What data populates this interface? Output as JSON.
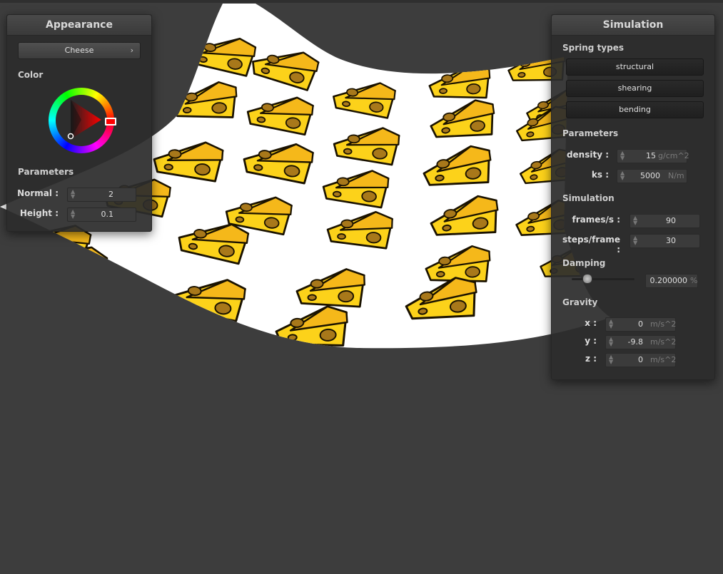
{
  "appearance": {
    "title": "Appearance",
    "texture_select": "Cheese",
    "color_label": "Color",
    "parameters_label": "Parameters",
    "normal": {
      "label": "Normal :",
      "value": "2"
    },
    "height": {
      "label": "Height :",
      "value": "0.1"
    },
    "selected_color": "#ff0000"
  },
  "simulation": {
    "title": "Simulation",
    "spring_types_label": "Spring types",
    "spring_buttons": [
      "structural",
      "shearing",
      "bending"
    ],
    "parameters_label": "Parameters",
    "density": {
      "label": "density :",
      "value": "15",
      "unit": "g/cm^2"
    },
    "ks": {
      "label": "ks :",
      "value": "5000",
      "unit": "N/m"
    },
    "sim_label": "Simulation",
    "fps": {
      "label": "frames/s :",
      "value": "90"
    },
    "steps": {
      "label": "steps/frame :",
      "value": "30"
    },
    "damping_label": "Damping",
    "damping": {
      "value": "0.200000",
      "unit": "%",
      "fraction": 0.2
    },
    "gravity_label": "Gravity",
    "gx": {
      "label": "x :",
      "value": "0",
      "unit": "m/s^2"
    },
    "gy": {
      "label": "y :",
      "value": "-9.8",
      "unit": "m/s^2"
    },
    "gz": {
      "label": "z :",
      "value": "0",
      "unit": "m/s^2"
    }
  },
  "colors": {
    "background": "#3d3d3d",
    "cloth": "#ffffff",
    "cheese": "#fcd21a",
    "cheese_edge": "#1a1200",
    "holes": "#a8781a"
  }
}
